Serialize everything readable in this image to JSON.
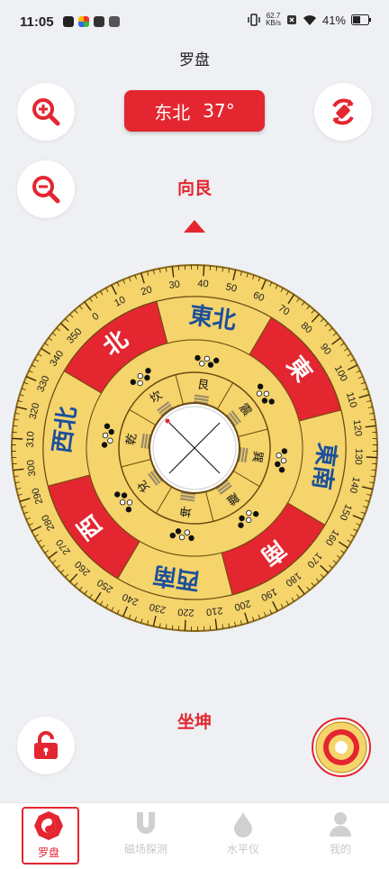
{
  "status": {
    "time": "11:05",
    "net_speed_value": "62.7",
    "net_speed_unit": "KB/s",
    "battery": "41%"
  },
  "page": {
    "title": "罗盘"
  },
  "heading": {
    "direction": "东北",
    "degrees": "37°"
  },
  "facing_label": "向艮",
  "sitting_label": "坐坤",
  "compass": {
    "outer_ticks": [
      "0",
      "10",
      "20",
      "30",
      "40",
      "50",
      "60",
      "70",
      "80",
      "90",
      "100",
      "110",
      "120",
      "130",
      "140",
      "150",
      "160",
      "170",
      "180",
      "190",
      "200",
      "210",
      "220",
      "230",
      "240",
      "250",
      "260",
      "270",
      "280",
      "290",
      "300",
      "310",
      "320",
      "330",
      "340",
      "350"
    ],
    "directions": [
      "北",
      "東北",
      "東",
      "東南",
      "南",
      "西南",
      "西",
      "西北"
    ],
    "trigrams": [
      "坎",
      "艮",
      "震",
      "巽",
      "離",
      "坤",
      "兌",
      "乾"
    ]
  },
  "tabs": [
    {
      "label": "罗盘",
      "icon": "bagua-icon",
      "active": true
    },
    {
      "label": "磁场探测",
      "icon": "magnet-icon",
      "active": false
    },
    {
      "label": "水平仪",
      "icon": "water-drop-icon",
      "active": false
    },
    {
      "label": "我的",
      "icon": "user-icon",
      "active": false
    }
  ],
  "colors": {
    "accent": "#e32630",
    "compass_gold": "#f5d46b",
    "compass_blue": "#1c4f9c"
  }
}
